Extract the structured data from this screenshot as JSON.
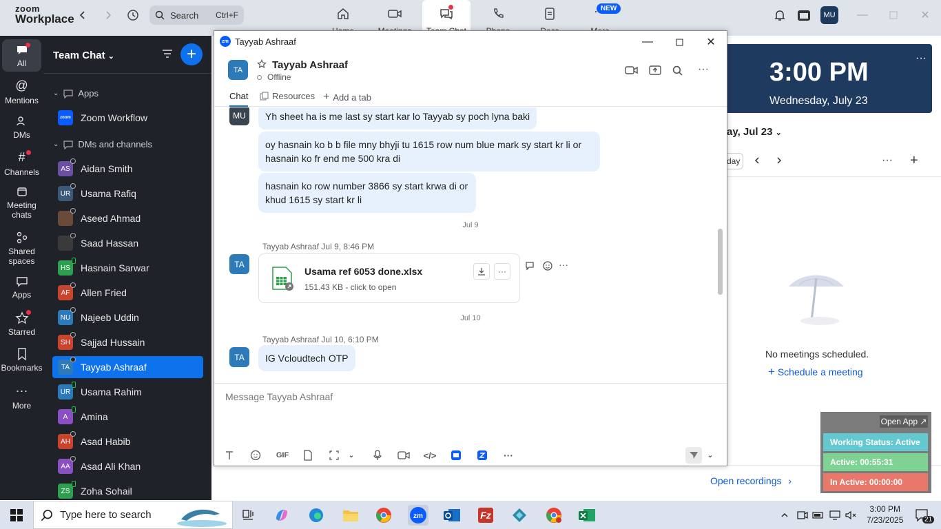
{
  "app": {
    "logo_line1": "zoom",
    "logo_line2": "Workplace"
  },
  "search": {
    "label": "Search",
    "shortcut": "Ctrl+F"
  },
  "nav": {
    "home": "Home",
    "meetings": "Meetings",
    "team_chat": "Team Chat",
    "phone": "Phone",
    "docs": "Docs",
    "more": "More",
    "new_badge": "NEW"
  },
  "user_avatar": "MU",
  "rail": {
    "all": "All",
    "mentions": "Mentions",
    "dms": "DMs",
    "channels": "Channels",
    "meeting_chats_1": "Meeting",
    "meeting_chats_2": "chats",
    "shared_1": "Shared",
    "shared_2": "spaces",
    "apps": "Apps",
    "starred": "Starred",
    "bookmarks": "Bookmarks",
    "more": "More"
  },
  "sidebar": {
    "title": "Team Chat",
    "apps_section": "Apps",
    "zoom_workflow": "Zoom Workflow",
    "dms_section": "DMs and channels",
    "contacts": [
      {
        "initials": "AS",
        "name": "Aidan Smith",
        "color": "#6b4fa0"
      },
      {
        "initials": "UR",
        "name": "Usama Rafiq",
        "color": "#3a5a78"
      },
      {
        "initials": "",
        "name": "Aseed Ahmad",
        "color": "#6a4a3a"
      },
      {
        "initials": "",
        "name": "Saad Hassan",
        "color": "#3a3a3a"
      },
      {
        "initials": "HS",
        "name": "Hasnain Sarwar",
        "color": "#2e9e4f"
      },
      {
        "initials": "AF",
        "name": "Allen Fried",
        "color": "#c9442f"
      },
      {
        "initials": "NU",
        "name": "Najeeb Uddin",
        "color": "#2d7ab8"
      },
      {
        "initials": "SH",
        "name": "Sajjad Hussain",
        "color": "#c9442f"
      },
      {
        "initials": "TA",
        "name": "Tayyab Ashraaf",
        "color": "#2d7ab8"
      },
      {
        "initials": "UR",
        "name": "Usama Rahim",
        "color": "#2d7ab8"
      },
      {
        "initials": "A",
        "name": "Amina",
        "color": "#8a4fc0"
      },
      {
        "initials": "AH",
        "name": "Asad Habib",
        "color": "#c9442f"
      },
      {
        "initials": "AA",
        "name": "Asad Ali Khan",
        "color": "#8a4fc0"
      },
      {
        "initials": "ZS",
        "name": "Zoha Sohail",
        "color": "#2e9e4f"
      }
    ],
    "selected_index": 8
  },
  "chat_window": {
    "title": "Tayyab Ashraaf",
    "avatar": "TA",
    "name": "Tayyab Ashraaf",
    "status": "Offline",
    "tabs": {
      "chat": "Chat",
      "resources": "Resources",
      "add": "Add a tab"
    },
    "messages": [
      {
        "avatar": "MU",
        "text": "Yh sheet ha is me last sy start kar lo Tayyab sy poch lyna baki"
      },
      {
        "text": "oy hasnain ko b b file mny bhyji tu 1615 row num blue mark sy start kr li or hasnain ko fr end me 500 kra di"
      },
      {
        "text": "hasnain ko row number 3866 sy start krwa di or khud 1615 sy start kr li"
      }
    ],
    "date1": "Jul 9",
    "file_meta_name": "Tayyab Ashraaf",
    "file_meta_time": "Jul 9, 8:46 PM",
    "file_name": "Usama ref 6053 done.xlsx",
    "file_info": "151.43 KB - click to open",
    "date2": "Jul 10",
    "msg2_meta_name": "Tayyab Ashraaf",
    "msg2_meta_time": "Jul 10, 6:10 PM",
    "msg2_text": "IG Vcloudtech OTP",
    "composer_placeholder": "Message Tayyab Ashraaf",
    "gif": "GIF"
  },
  "right_panel": {
    "time": "3:00 PM",
    "date": "Wednesday, July 23",
    "day_selector": "ay, Jul 23",
    "today_btn": "day",
    "no_meetings": "No meetings scheduled.",
    "schedule": "Schedule a meeting",
    "open_recordings": "Open recordings"
  },
  "widget": {
    "open_app": "Open App ↗",
    "working": "Working Status: Active",
    "active": "Active: 00:55:31",
    "inactive": "In Active: 00:00:00",
    "colors": {
      "working": "#63c8d0",
      "active": "#7ed394",
      "inactive": "#e8786a"
    }
  },
  "taskbar": {
    "search": "Type here to search",
    "time": "3:00 PM",
    "date": "7/23/2025",
    "notif": "21"
  }
}
